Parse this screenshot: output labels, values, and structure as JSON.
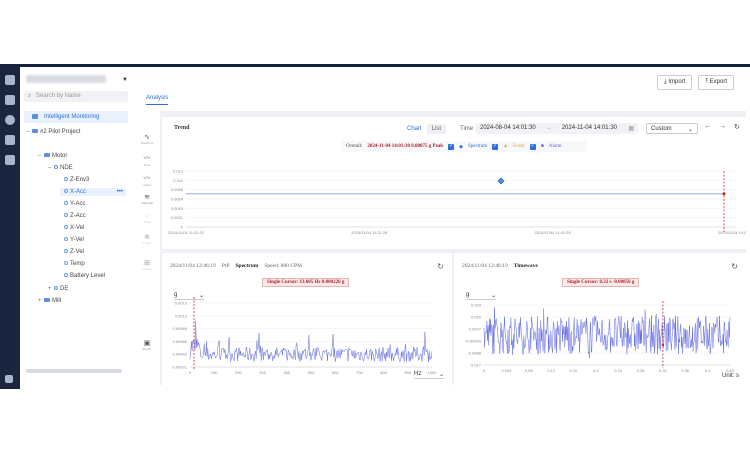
{
  "tree": {
    "search_placeholder": "Search by Name",
    "intelligent_monitoring": "Intelligent Monitoring",
    "pilot_project": "#2 Pilot Project",
    "motor": "Motor",
    "nde": "NDE",
    "points": [
      "Z-Env3",
      "X-Acc",
      "Y-Acc",
      "Z-Acc",
      "X-Vel",
      "Y-Vel",
      "Z-Vel",
      "Temp",
      "Battery Level"
    ],
    "de": "DE",
    "mill": "Mill",
    "more": "•••"
  },
  "header": {
    "import_label": "Import",
    "export_label": "Export",
    "analysis_tab": "Analysis"
  },
  "trend": {
    "title": "Trend",
    "chart_tab": "Chart",
    "list_tab": "List",
    "time_label": "Time",
    "start": "2024-08-04 14:01:30",
    "arrow": "→",
    "end": "2024-11-04 14:01:30",
    "range_mode": "Custom",
    "overall_label": "Overall:",
    "overall_value": "2024-11-04 14:01:30 0.00075 g Peak",
    "legend": [
      "Spectrum",
      "Event",
      "Alarm"
    ]
  },
  "spectrum": {
    "timestamp": "2024/11/04 12:46:19",
    "ptp": "PtP",
    "title": "Spectrum",
    "speed": "Speed: 800 CPM",
    "cursor": "Single Cursor: 13.605 Hz 0.000226 g",
    "unit_select": "g",
    "x_unit": "Hz"
  },
  "timewave": {
    "timestamp": "2024/11/04 12:46:19",
    "title": "Timewave",
    "cursor": "Single Cursor: 0.32 s -0.00856 g",
    "unit_select": "g",
    "x_unit": "Unit: s"
  },
  "tools": [
    "Spectrum",
    "Time",
    "Trend",
    "Waterfall",
    "Orbit",
    "Phase",
    "Cursor",
    "Export"
  ],
  "chart_data": [
    {
      "type": "scatter",
      "title": "Trend",
      "ylim": [
        0,
        0.013
      ],
      "yticks": [
        "0.013",
        "0.011",
        "0.0085",
        "0.0064",
        "0.0043",
        "0.0021",
        "0"
      ],
      "xticks": [
        "2024/11/04 11:01:31",
        "2024/11/04 11:21:28",
        "2024/11/04 11:41:25",
        "2024/11/04 14:01:21"
      ],
      "series": [
        {
          "name": "Spectrum",
          "values": [
            0.0077
          ]
        }
      ]
    },
    {
      "type": "line",
      "title": "Spectrum",
      "ylim": [
        0,
        0.0015
      ],
      "yticks": [
        "0.0015",
        "0.0012",
        "0.00089",
        "0.00066",
        "0.00042",
        "0.00021"
      ],
      "xticks": [
        "0",
        "100",
        "200",
        "300",
        "400",
        "500",
        "600",
        "700",
        "800",
        "900",
        "1000"
      ],
      "xlim": [
        0,
        1000
      ]
    },
    {
      "type": "line",
      "title": "Timewave",
      "ylim": [
        -0.02,
        0.02
      ],
      "yticks": [
        "0.024",
        "0.016",
        "0.0077",
        "-0.00043",
        "-0.0088",
        "-0.017"
      ],
      "xticks": [
        "0",
        "0.004",
        "0.08",
        "0.12",
        "0.16",
        "0.2",
        "0.24",
        "0.28",
        "0.32",
        "0.36",
        "0.4",
        "0.44"
      ],
      "xlim": [
        0,
        0.44
      ]
    }
  ]
}
